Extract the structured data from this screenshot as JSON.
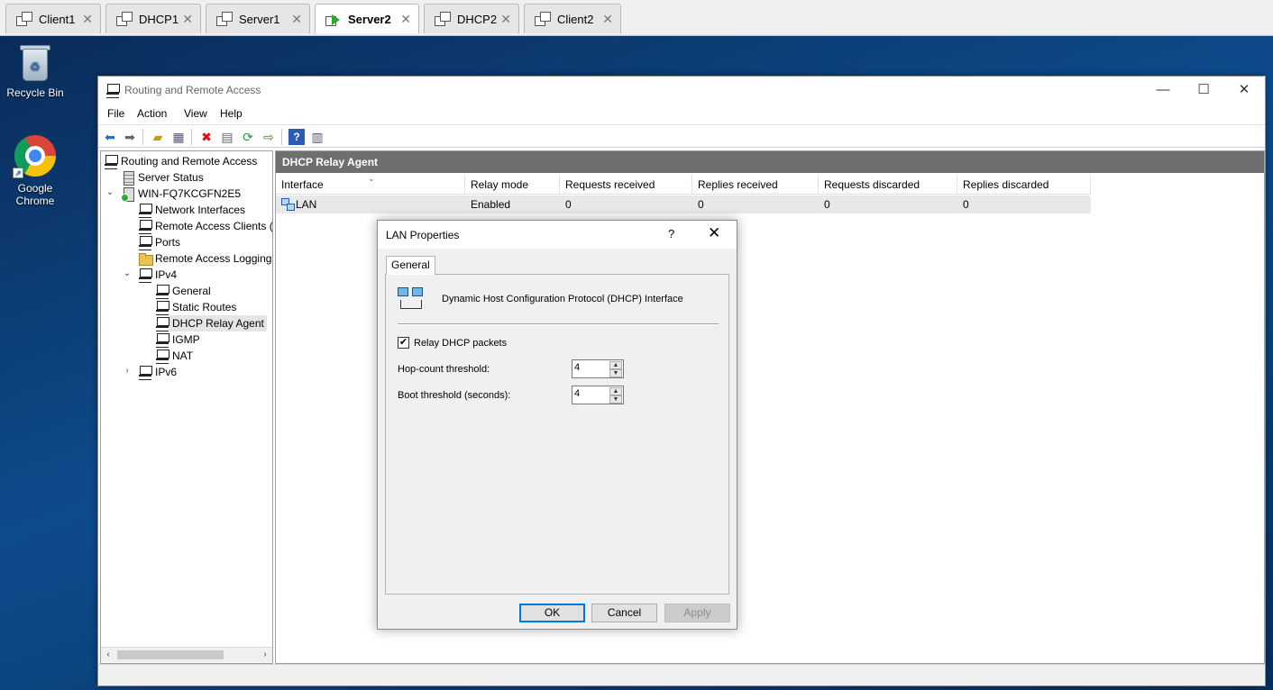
{
  "vm_tabs": [
    {
      "label": "Client1",
      "active": false
    },
    {
      "label": "DHCP1",
      "active": false
    },
    {
      "label": "Server1",
      "active": false
    },
    {
      "label": "Server2",
      "active": true
    },
    {
      "label": "DHCP2",
      "active": false
    },
    {
      "label": "Client2",
      "active": false
    }
  ],
  "tab_close_glyph": "✕",
  "desktop": {
    "icons": [
      {
        "label": "Recycle Bin",
        "icon": "recycle-bin-icon"
      },
      {
        "label": "Google Chrome",
        "icon": "chrome-icon"
      }
    ]
  },
  "window": {
    "title": "Routing and Remote Access",
    "controls": {
      "minimize": "—",
      "maximize": "☐",
      "close": "✕"
    }
  },
  "menu": [
    "File",
    "Action",
    "View",
    "Help"
  ],
  "toolbar_icons": [
    "back-arrow-icon",
    "forward-arrow-icon",
    "up-folder-icon",
    "show-hide-tree-icon",
    "delete-icon",
    "properties-icon",
    "refresh-icon",
    "export-list-icon",
    "help-icon",
    "action-pane-icon"
  ],
  "tree": {
    "root": "Routing and Remote Access",
    "server_status": "Server Status",
    "server": "WIN-FQ7KCGFN2E5",
    "children": {
      "network_interfaces": "Network Interfaces",
      "remote_access_clients": "Remote Access Clients (",
      "ports": "Ports",
      "remote_access_logging": "Remote Access Logging",
      "ipv4": "IPv4",
      "ipv4_children": [
        "General",
        "Static Routes",
        "DHCP Relay Agent",
        "IGMP",
        "NAT"
      ],
      "ipv6": "IPv6"
    },
    "selected": "DHCP Relay Agent"
  },
  "result_pane": {
    "header": "DHCP Relay Agent",
    "columns": [
      "Interface",
      "Relay mode",
      "Requests received",
      "Replies received",
      "Requests discarded",
      "Replies discarded"
    ],
    "rows": [
      {
        "interface": "LAN",
        "relay_mode": "Enabled",
        "requests_received": "0",
        "replies_received": "0",
        "requests_discarded": "0",
        "replies_discarded": "0"
      }
    ]
  },
  "dialog": {
    "title": "LAN Properties",
    "help_glyph": "?",
    "close_glyph": "✕",
    "tab": "General",
    "description": "Dynamic Host Configuration Protocol (DHCP) Interface",
    "relay_checkbox": {
      "label": "Relay DHCP packets",
      "checked": true,
      "mark": "✔"
    },
    "hop_count": {
      "label": "Hop-count threshold:",
      "value": "4"
    },
    "boot_threshold": {
      "label": "Boot threshold (seconds):",
      "value": "4"
    },
    "buttons": {
      "ok": "OK",
      "cancel": "Cancel",
      "apply": "Apply"
    }
  },
  "colors": {
    "accent": "#0078d7",
    "pane_header_bg": "#6f6f6f",
    "selected_row_bg": "#e8e8e8"
  }
}
